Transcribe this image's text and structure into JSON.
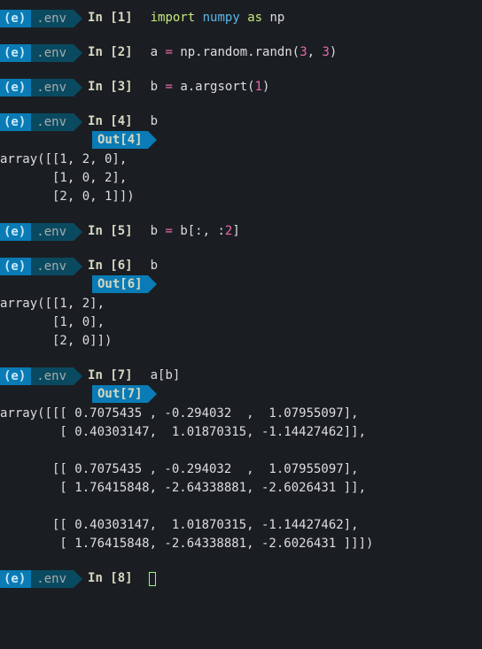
{
  "env": {
    "badge1": "(e)",
    "badge2": ".env"
  },
  "cells": {
    "c1": {
      "in_label": "In [1]",
      "code_import": "import",
      "code_mod": "numpy",
      "code_as": "as",
      "code_alias": "np"
    },
    "c2": {
      "in_label": "In [2]",
      "code_pre": "a ",
      "code_op": "=",
      "code_post": " np.random.randn(",
      "code_n1": "3",
      "code_comma": ", ",
      "code_n2": "3",
      "code_close": ")"
    },
    "c3": {
      "in_label": "In [3]",
      "code_pre": "b ",
      "code_op": "=",
      "code_post": " a.argsort(",
      "code_n": "1",
      "code_close": ")"
    },
    "c4": {
      "in_label": "In [4]",
      "code": "b",
      "out_label": "Out[4]",
      "output": "array([[1, 2, 0],\n       [1, 0, 2],\n       [2, 0, 1]])"
    },
    "c5": {
      "in_label": "In [5]",
      "code_pre": "b ",
      "code_op": "=",
      "code_post": " b[:, :",
      "code_n": "2",
      "code_close": "]"
    },
    "c6": {
      "in_label": "In [6]",
      "code": "b",
      "out_label": "Out[6]",
      "output": "array([[1, 2],\n       [1, 0],\n       [2, 0]])"
    },
    "c7": {
      "in_label": "In [7]",
      "code": "a[b]",
      "out_label": "Out[7]",
      "output": "array([[[ 0.7075435 , -0.294032  ,  1.07955097],\n        [ 0.40303147,  1.01870315, -1.14427462]],\n\n       [[ 0.7075435 , -0.294032  ,  1.07955097],\n        [ 1.76415848, -2.64338881, -2.6026431 ]],\n\n       [[ 0.40303147,  1.01870315, -1.14427462],\n        [ 1.76415848, -2.64338881, -2.6026431 ]]])"
    },
    "c8": {
      "in_label": "In [8]"
    }
  }
}
